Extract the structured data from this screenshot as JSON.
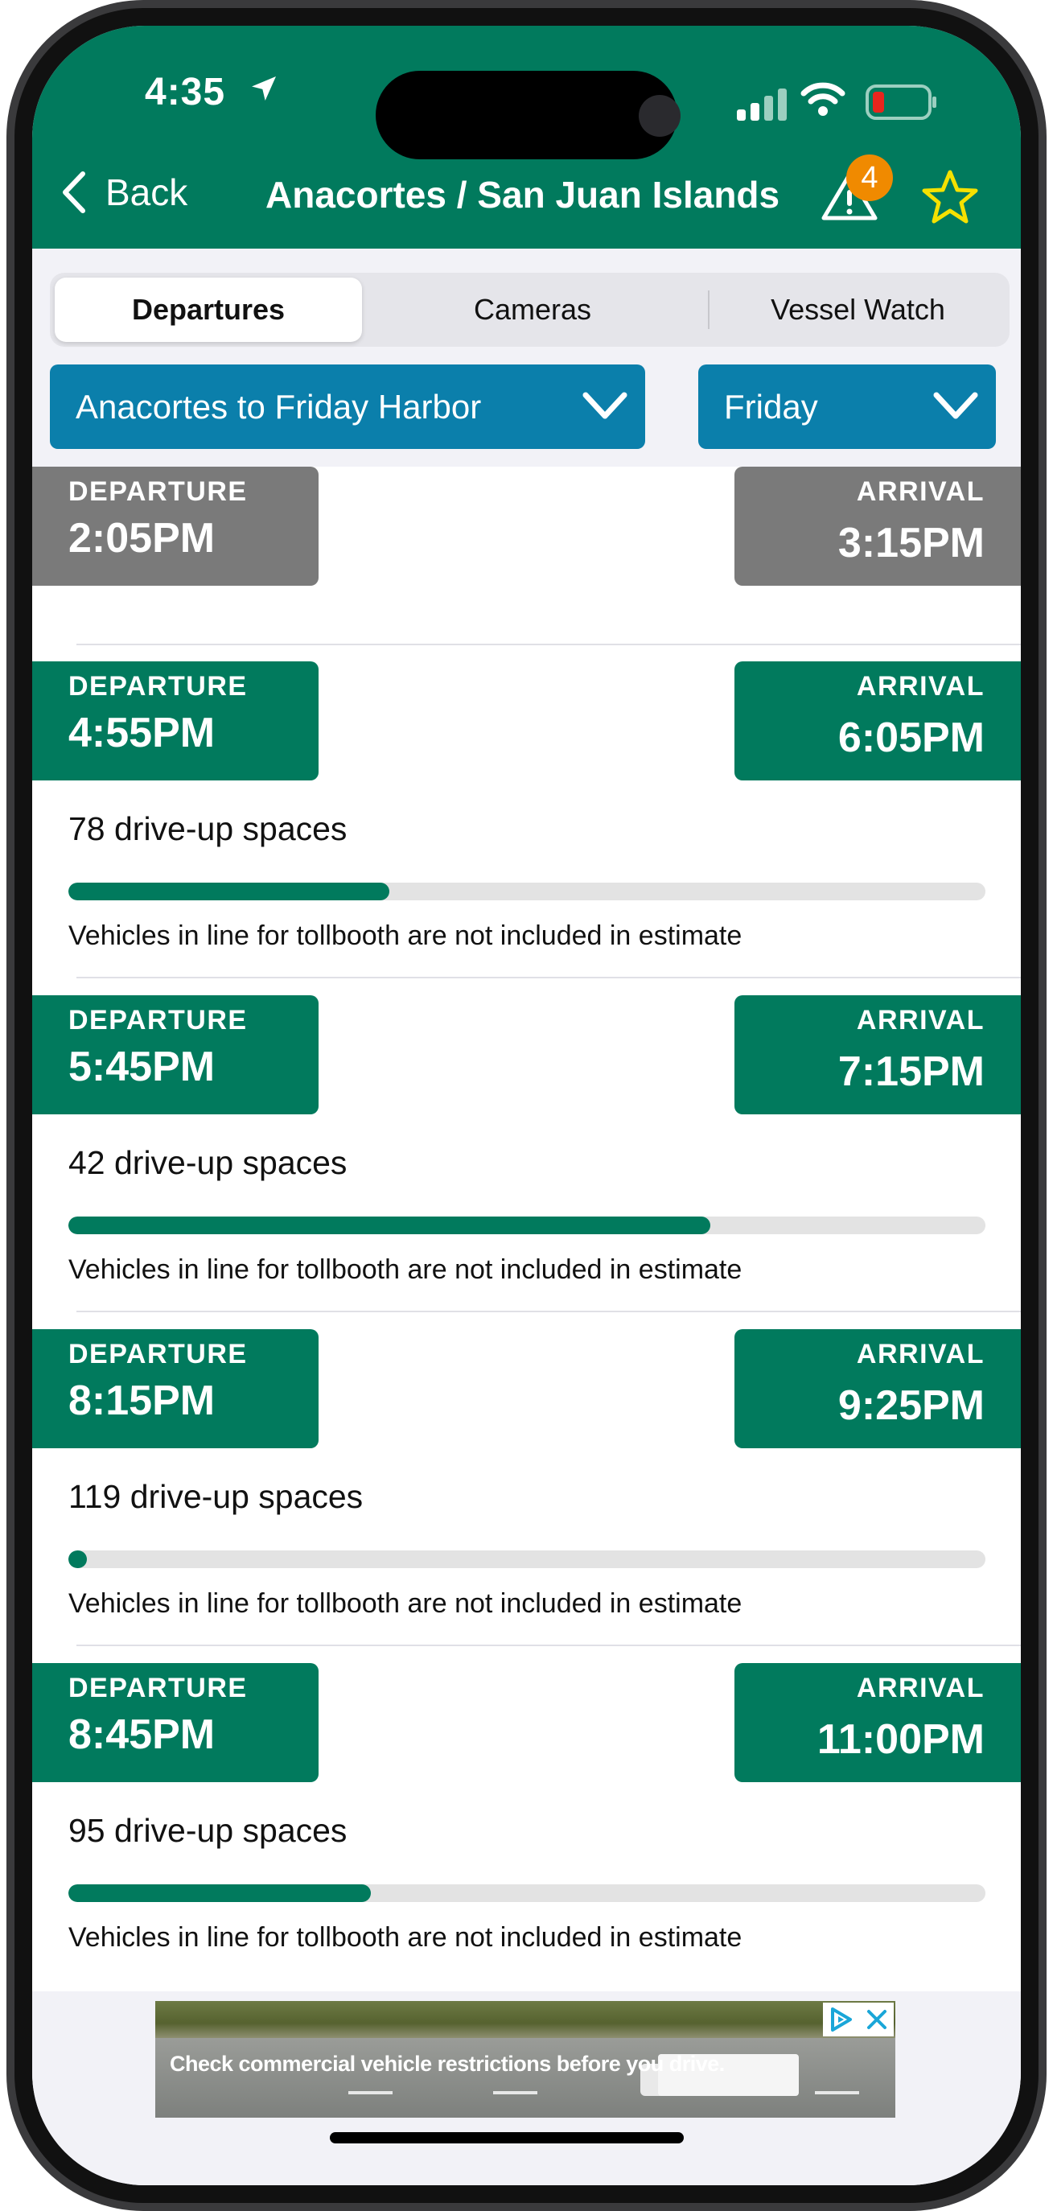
{
  "status_bar": {
    "time": "4:35"
  },
  "nav": {
    "back_label": "Back",
    "title": "Anacortes / San Juan Islands",
    "alert_count": "4",
    "alert_icon": "warning-triangle-icon",
    "favorite_icon": "star-outline-icon"
  },
  "tabs": [
    {
      "label": "Departures",
      "active": true
    },
    {
      "label": "Cameras",
      "active": false
    },
    {
      "label": "Vessel Watch",
      "active": false
    }
  ],
  "route_select": {
    "value": "Anacortes to Friday Harbor"
  },
  "day_select": {
    "value": "Friday"
  },
  "sailings": [
    {
      "dep_label": "DEPARTURE",
      "dep_time": "2:05PM",
      "arr_label": "ARRIVAL",
      "arr_time": "3:15PM",
      "past": true
    },
    {
      "dep_label": "DEPARTURE",
      "dep_time": "4:55PM",
      "arr_label": "ARRIVAL",
      "arr_time": "6:05PM",
      "spaces": "78 drive-up spaces",
      "fill_fraction": 0.35,
      "note": "Vehicles in line for tollbooth are not included in estimate"
    },
    {
      "dep_label": "DEPARTURE",
      "dep_time": "5:45PM",
      "arr_label": "ARRIVAL",
      "arr_time": "7:15PM",
      "spaces": "42 drive-up spaces",
      "fill_fraction": 0.7,
      "note": "Vehicles in line for tollbooth are not included in estimate"
    },
    {
      "dep_label": "DEPARTURE",
      "dep_time": "8:15PM",
      "arr_label": "ARRIVAL",
      "arr_time": "9:25PM",
      "spaces": "119 drive-up spaces",
      "fill_fraction": 0.02,
      "note": "Vehicles in line for tollbooth are not included in estimate"
    },
    {
      "dep_label": "DEPARTURE",
      "dep_time": "8:45PM",
      "arr_label": "ARRIVAL",
      "arr_time": "11:00PM",
      "spaces": "95 drive-up spaces",
      "fill_fraction": 0.33,
      "note": "Vehicles in line for tollbooth are not included in estimate"
    }
  ],
  "ad": {
    "text": "Check commercial vehicle restrictions before you drive."
  },
  "colors": {
    "brand_green": "#017a5d",
    "selector_blue": "#0b7fab",
    "past_gray": "#7a7a7a",
    "alert_orange": "#f08a00",
    "star_yellow": "#f5e100"
  }
}
